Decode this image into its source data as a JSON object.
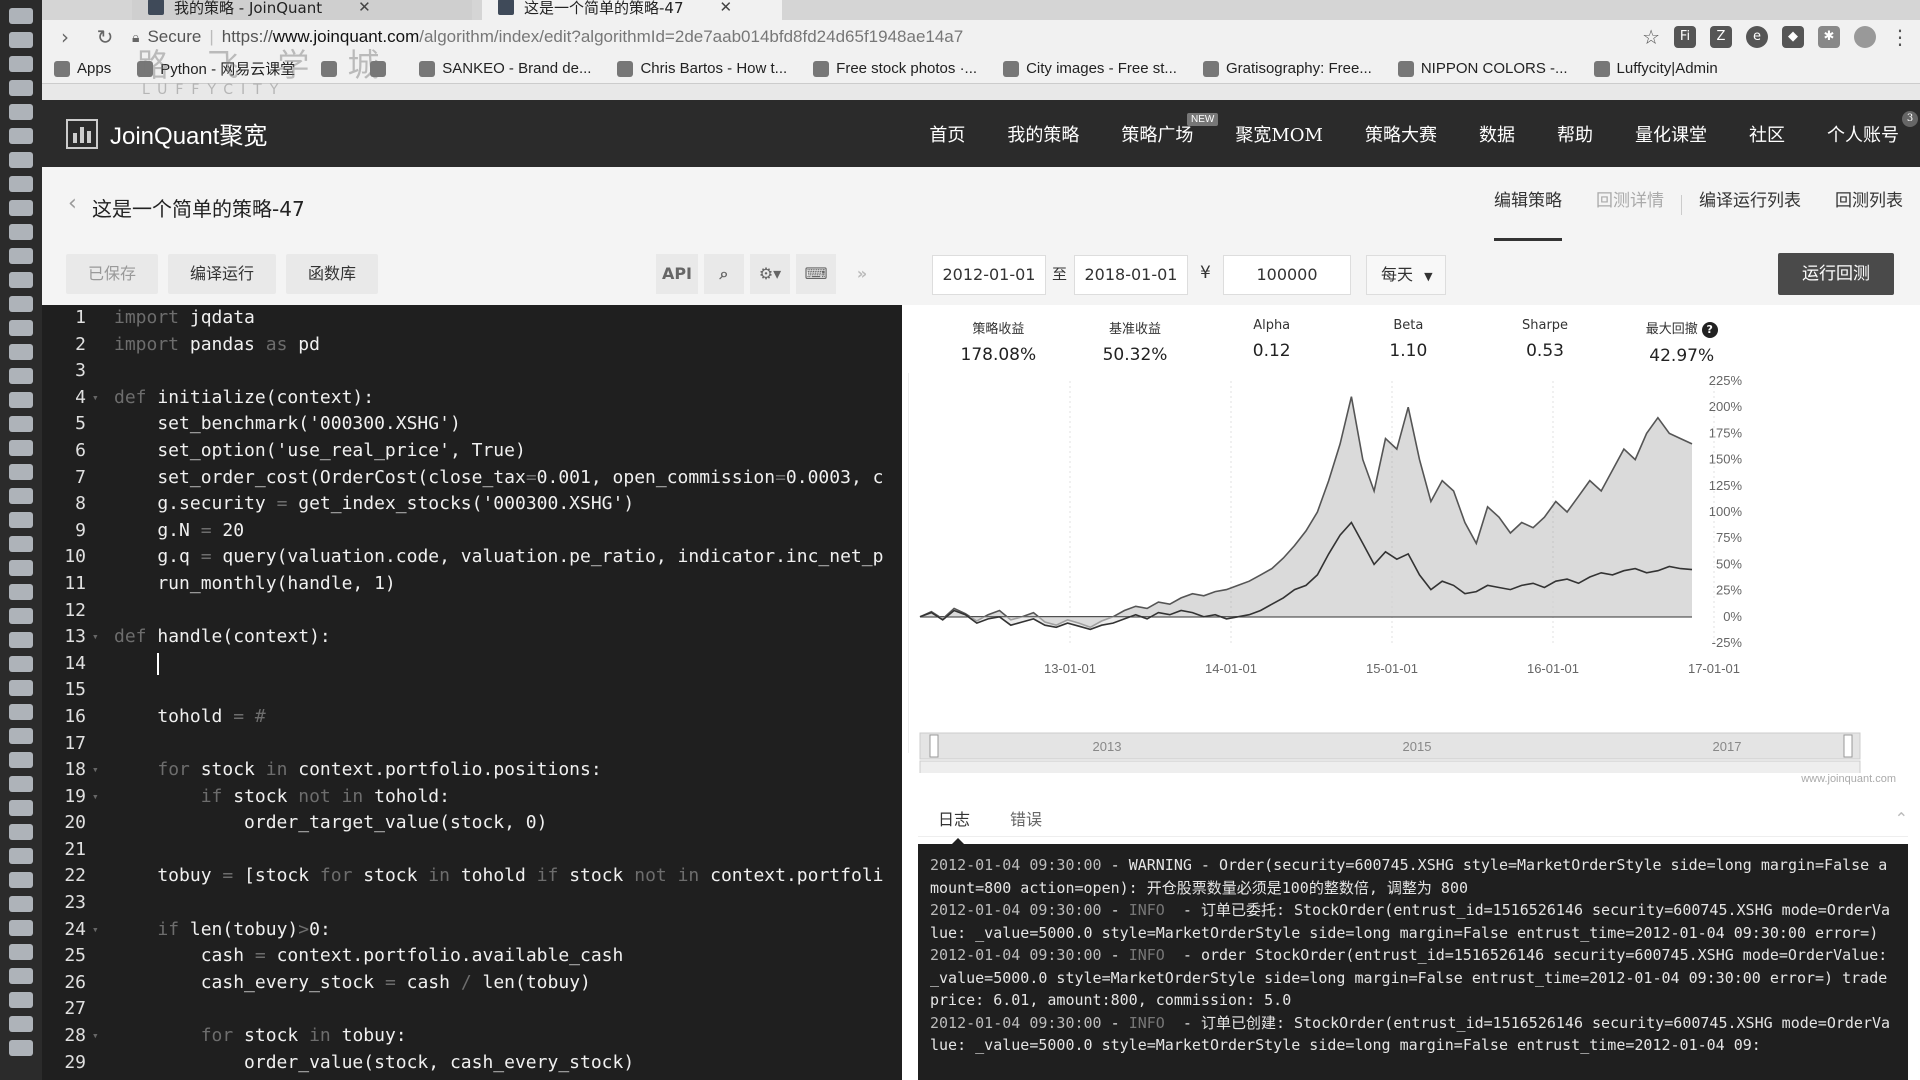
{
  "browser": {
    "tabs": [
      {
        "label": "我的策略 - JoinQuant"
      },
      {
        "label": "这是一个简单的策略-47"
      }
    ],
    "url": {
      "secure_label": "Secure",
      "scheme": "https://",
      "host": "www.joinquant.com",
      "path": "/algorithm/index/edit?algorithmId=2de7aab014bfd8fd24d65f1948ae14a7"
    },
    "bookmarks": [
      {
        "label": "Apps"
      },
      {
        "label": "Python - 网易云课堂"
      },
      {
        "label": ""
      },
      {
        "label": ""
      },
      {
        "label": "SANKEO - Brand de..."
      },
      {
        "label": "Chris Bartos - How t..."
      },
      {
        "label": "Free stock photos ·..."
      },
      {
        "label": "City images - Free st..."
      },
      {
        "label": "Gratisography: Free..."
      },
      {
        "label": "NIPPON COLORS -..."
      },
      {
        "label": "Luffycity|Admin"
      }
    ],
    "watermark": "路 飞 学 城",
    "watermark_sub": "LUFFYCITY"
  },
  "site": {
    "logo": "JoinQuant聚宽",
    "nav": [
      {
        "label": "首页"
      },
      {
        "label": "我的策略"
      },
      {
        "label": "策略广场",
        "badge": "NEW"
      },
      {
        "label": "聚宽MOM"
      },
      {
        "label": "策略大赛"
      },
      {
        "label": "数据"
      },
      {
        "label": "帮助"
      },
      {
        "label": "量化课堂"
      },
      {
        "label": "社区"
      },
      {
        "label": "个人账号",
        "count": "3"
      }
    ]
  },
  "subheader": {
    "title": "这是一个简单的策略-47",
    "tabs": [
      {
        "label": "编辑策略"
      },
      {
        "label": "回测详情"
      },
      {
        "label": "编译运行列表"
      },
      {
        "label": "回测列表"
      }
    ]
  },
  "editor": {
    "toolbar": {
      "saved": "已保存",
      "compile_run": "编译运行",
      "func_lib": "函数库",
      "api": "API"
    },
    "lines": [
      {
        "n": "1",
        "fold": "",
        "html": "<span class='kw'>import</span> jqdata"
      },
      {
        "n": "2",
        "fold": "",
        "html": "<span class='kw'>import</span> pandas <span class='kw'>as</span> pd"
      },
      {
        "n": "3",
        "fold": "",
        "html": ""
      },
      {
        "n": "4",
        "fold": "▾",
        "html": "<span class='kw'>def</span> initialize(context):"
      },
      {
        "n": "5",
        "fold": "",
        "html": "    set_benchmark('000300.XSHG')"
      },
      {
        "n": "6",
        "fold": "",
        "html": "    set_option('use_real_price', True)"
      },
      {
        "n": "7",
        "fold": "",
        "html": "    set_order_cost(OrderCost(close_tax<span class='op'>=</span>0.001, open_commission<span class='op'>=</span>0.0003, c"
      },
      {
        "n": "8",
        "fold": "",
        "html": "    g.security <span class='op'>=</span> get_index_stocks('000300.XSHG')"
      },
      {
        "n": "9",
        "fold": "",
        "html": "    g.N <span class='op'>=</span> 20"
      },
      {
        "n": "10",
        "fold": "",
        "html": "    g.q <span class='op'>=</span> query(valuation.code, valuation.pe_ratio, indicator.inc_net_p"
      },
      {
        "n": "11",
        "fold": "",
        "html": "    run_monthly(handle, 1)"
      },
      {
        "n": "12",
        "fold": "",
        "html": ""
      },
      {
        "n": "13",
        "fold": "▾",
        "html": "<span class='kw'>def</span> handle(context):"
      },
      {
        "n": "14",
        "fold": "",
        "html": "    <span class='caret'></span>"
      },
      {
        "n": "15",
        "fold": "",
        "html": ""
      },
      {
        "n": "16",
        "fold": "",
        "html": "    tohold <span class='op'>= #</span>"
      },
      {
        "n": "17",
        "fold": "",
        "html": ""
      },
      {
        "n": "18",
        "fold": "▾",
        "html": "    <span class='kw'>for</span> stock <span class='kw'>in</span> context.portfolio.positions:"
      },
      {
        "n": "19",
        "fold": "▾",
        "html": "        <span class='kw'>if</span> stock <span class='kw'>not in</span> tohold:"
      },
      {
        "n": "20",
        "fold": "",
        "html": "            order_target_value(stock, 0)"
      },
      {
        "n": "21",
        "fold": "",
        "html": ""
      },
      {
        "n": "22",
        "fold": "",
        "html": "    tobuy <span class='op'>=</span> [stock <span class='kw'>for</span> stock <span class='kw'>in</span> tohold <span class='kw'>if</span> stock <span class='kw'>not in</span> context.portfoli"
      },
      {
        "n": "23",
        "fold": "",
        "html": ""
      },
      {
        "n": "24",
        "fold": "▾",
        "html": "    <span class='kw'>if</span> len(tobuy)<span class='op'>&gt;</span>0:"
      },
      {
        "n": "25",
        "fold": "",
        "html": "        cash <span class='op'>=</span> context.portfolio.available_cash"
      },
      {
        "n": "26",
        "fold": "",
        "html": "        cash_every_stock <span class='op'>=</span> cash <span class='op'>/</span> len(tobuy)"
      },
      {
        "n": "27",
        "fold": "",
        "html": ""
      },
      {
        "n": "28",
        "fold": "▾",
        "html": "        <span class='kw'>for</span> stock <span class='kw'>in</span> tobuy:"
      },
      {
        "n": "29",
        "fold": "",
        "html": "            order_value(stock, cash_every_stock)"
      }
    ]
  },
  "backtest": {
    "start_date": "2012-01-01",
    "to_label": "至",
    "end_date": "2018-01-01",
    "currency": "¥",
    "capital": "100000",
    "frequency": "每天",
    "run_button": "运行回测",
    "metrics": [
      {
        "label": "策略收益",
        "value": "178.08%"
      },
      {
        "label": "基准收益",
        "value": "50.32%"
      },
      {
        "label": "Alpha",
        "value": "0.12"
      },
      {
        "label": "Beta",
        "value": "1.10"
      },
      {
        "label": "Sharpe",
        "value": "0.53"
      },
      {
        "label": "最大回撤",
        "value": "42.97%"
      }
    ],
    "credit": "www.joinquant.com"
  },
  "chart_data": {
    "type": "area",
    "x_ticks": [
      "13-01-01",
      "14-01-01",
      "15-01-01",
      "16-01-01",
      "17-01-01"
    ],
    "y_ticks": [
      "225%",
      "200%",
      "175%",
      "150%",
      "125%",
      "100%",
      "75%",
      "50%",
      "25%",
      "0%",
      "-25%"
    ],
    "ylim": [
      -25,
      225
    ],
    "navigator_years": [
      "2013",
      "2015",
      "2017"
    ],
    "series": [
      {
        "values": [
          0,
          5,
          -2,
          8,
          3,
          -4,
          2,
          6,
          -3,
          0,
          4,
          -5,
          -8,
          -3,
          -6,
          -10,
          -4,
          0,
          6,
          10,
          8,
          14,
          12,
          18,
          22,
          20,
          24,
          26,
          30,
          34,
          40,
          46,
          56,
          68,
          82,
          100,
          130,
          165,
          210,
          150,
          120,
          170,
          160,
          200,
          150,
          110,
          130,
          120,
          90,
          70,
          105,
          95,
          80,
          90,
          85,
          95,
          110,
          100,
          115,
          130,
          120,
          140,
          160,
          150,
          175,
          190,
          175,
          170,
          165
        ]
      },
      {
        "values": [
          0,
          4,
          -3,
          6,
          2,
          -6,
          -2,
          0,
          -8,
          -5,
          -2,
          -8,
          -10,
          -6,
          -9,
          -12,
          -8,
          -6,
          -2,
          2,
          -2,
          4,
          2,
          6,
          4,
          0,
          2,
          -2,
          0,
          2,
          6,
          12,
          18,
          26,
          30,
          40,
          60,
          78,
          90,
          70,
          50,
          62,
          55,
          60,
          40,
          26,
          34,
          30,
          22,
          24,
          30,
          28,
          26,
          30,
          32,
          28,
          34,
          36,
          32,
          38,
          42,
          40,
          44,
          46,
          42,
          44,
          48,
          46,
          45
        ]
      }
    ]
  },
  "log": {
    "tabs": [
      {
        "label": "日志"
      },
      {
        "label": "错误"
      }
    ],
    "entries": [
      {
        "time": "2012-01-04 09:30:00",
        "level": "WARNING",
        "muted": false,
        "text": "Order(security=600745.XSHG style=MarketOrderStyle side=long margin=False amount=800 action=open): 开仓股票数量必须是100的整数倍, 调整为 800"
      },
      {
        "time": "2012-01-04 09:30:00",
        "level": "INFO",
        "muted": true,
        "text": "订单已委托: StockOrder(entrust_id=1516526146 security=600745.XSHG mode=OrderValue: _value=5000.0 style=MarketOrderStyle side=long margin=False entrust_time=2012-01-04 09:30:00 error=)"
      },
      {
        "time": "2012-01-04 09:30:00",
        "level": "INFO",
        "muted": true,
        "text": "order StockOrder(entrust_id=1516526146 security=600745.XSHG mode=OrderValue: _value=5000.0 style=MarketOrderStyle side=long margin=False entrust_time=2012-01-04 09:30:00 error=) trade price: 6.01, amount:800, commission: 5.0"
      },
      {
        "time": "2012-01-04 09:30:00",
        "level": "INFO",
        "muted": true,
        "text": "订单已创建: StockOrder(entrust_id=1516526146 security=600745.XSHG mode=OrderValue: _value=5000.0 style=MarketOrderStyle side=long margin=False entrust_time=2012-01-04 09:"
      }
    ]
  }
}
